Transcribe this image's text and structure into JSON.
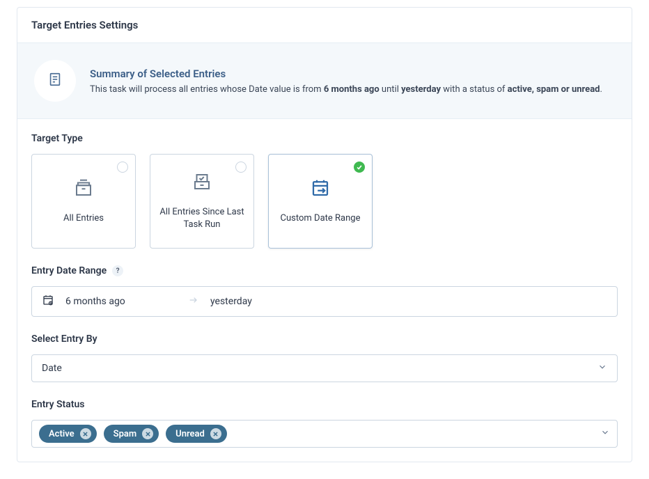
{
  "card": {
    "title": "Target Entries Settings"
  },
  "summary": {
    "title": "Summary of Selected Entries",
    "desc_prefix": "This task will process all entries whose Date value is from ",
    "desc_bold1": "6 months ago",
    "desc_mid": " until ",
    "desc_bold2": "yesterday",
    "desc_mid2": " with a status of ",
    "desc_bold3": "active, spam or unread",
    "desc_suffix": "."
  },
  "target_type": {
    "label": "Target Type",
    "options": [
      {
        "label": "All Entries"
      },
      {
        "label": "All Entries Since Last Task Run"
      },
      {
        "label": "Custom Date Range"
      }
    ],
    "selected_index": 2
  },
  "date_range": {
    "label": "Entry Date Range",
    "help": "?",
    "from": "6 months ago",
    "to": "yesterday"
  },
  "select_by": {
    "label": "Select Entry By",
    "value": "Date"
  },
  "entry_status": {
    "label": "Entry Status",
    "tags": [
      "Active",
      "Spam",
      "Unread"
    ]
  }
}
